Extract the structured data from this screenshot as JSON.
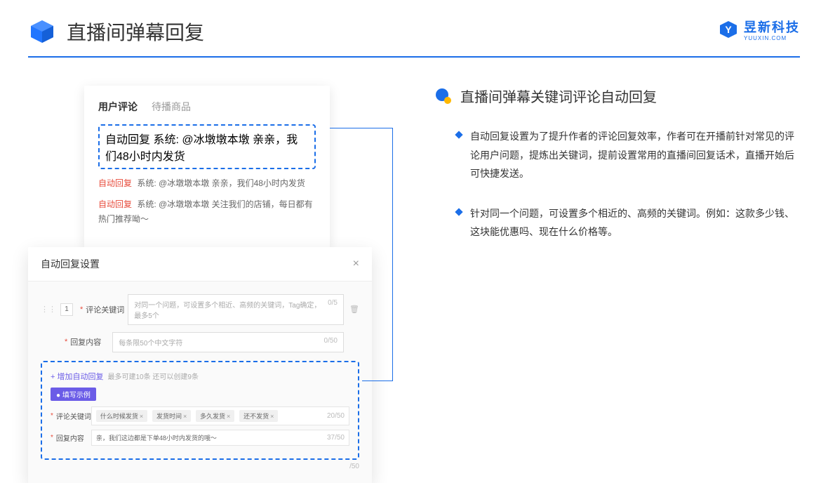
{
  "header": {
    "title": "直播间弹幕回复"
  },
  "brand": {
    "name": "昱新科技",
    "sub": "YUUXIN.COM"
  },
  "comments_panel": {
    "tabs": [
      "用户评论",
      "待播商品"
    ],
    "highlight": {
      "tag": "自动回复",
      "sys": "系统:",
      "text": "@冰墩墩本墩 亲亲，我们48小时内发货"
    },
    "rows": [
      {
        "tag": "自动回复",
        "sys": "系统:",
        "text": "@冰墩墩本墩 亲亲，我们48小时内发货"
      },
      {
        "tag": "自动回复",
        "sys": "系统:",
        "text": "@冰墩墩本墩 关注我们的店铺，每日都有热门推荐呦～"
      }
    ]
  },
  "settings_panel": {
    "title": "自动回复设置",
    "row_num": "1",
    "keyword_label": "评论关键词",
    "keyword_placeholder": "对同一个问题，可设置多个相近、高频的关键词，Tag确定，最多5个",
    "keyword_counter": "0/5",
    "content_label": "回复内容",
    "content_placeholder": "每条限50个中文字符",
    "content_counter": "0/50",
    "add_link": "+ 增加自动回复",
    "add_hint": "最多可建10条 还可以创建9条",
    "example_badge": "● 填写示例",
    "example_keyword_label": "评论关键词",
    "example_tags": [
      "什么时候发货",
      "发货时间",
      "多久发货",
      "还不发货"
    ],
    "example_keyword_counter": "20/50",
    "example_content_label": "回复内容",
    "example_content_text": "亲，我们这边都是下单48小时内发货的哦～",
    "example_content_counter": "37/50",
    "outer_counter": "/50"
  },
  "right": {
    "title": "直播间弹幕关键词评论自动回复",
    "bullets": [
      "自动回复设置为了提升作者的评论回复效率，作者可在开播前针对常见的评论用户问题，提炼出关键词，提前设置常用的直播间回复话术，直播开始后可快捷发送。",
      "针对同一个问题，可设置多个相近的、高频的关键词。例如：这款多少钱、这块能优惠吗、现在什么价格等。"
    ]
  }
}
